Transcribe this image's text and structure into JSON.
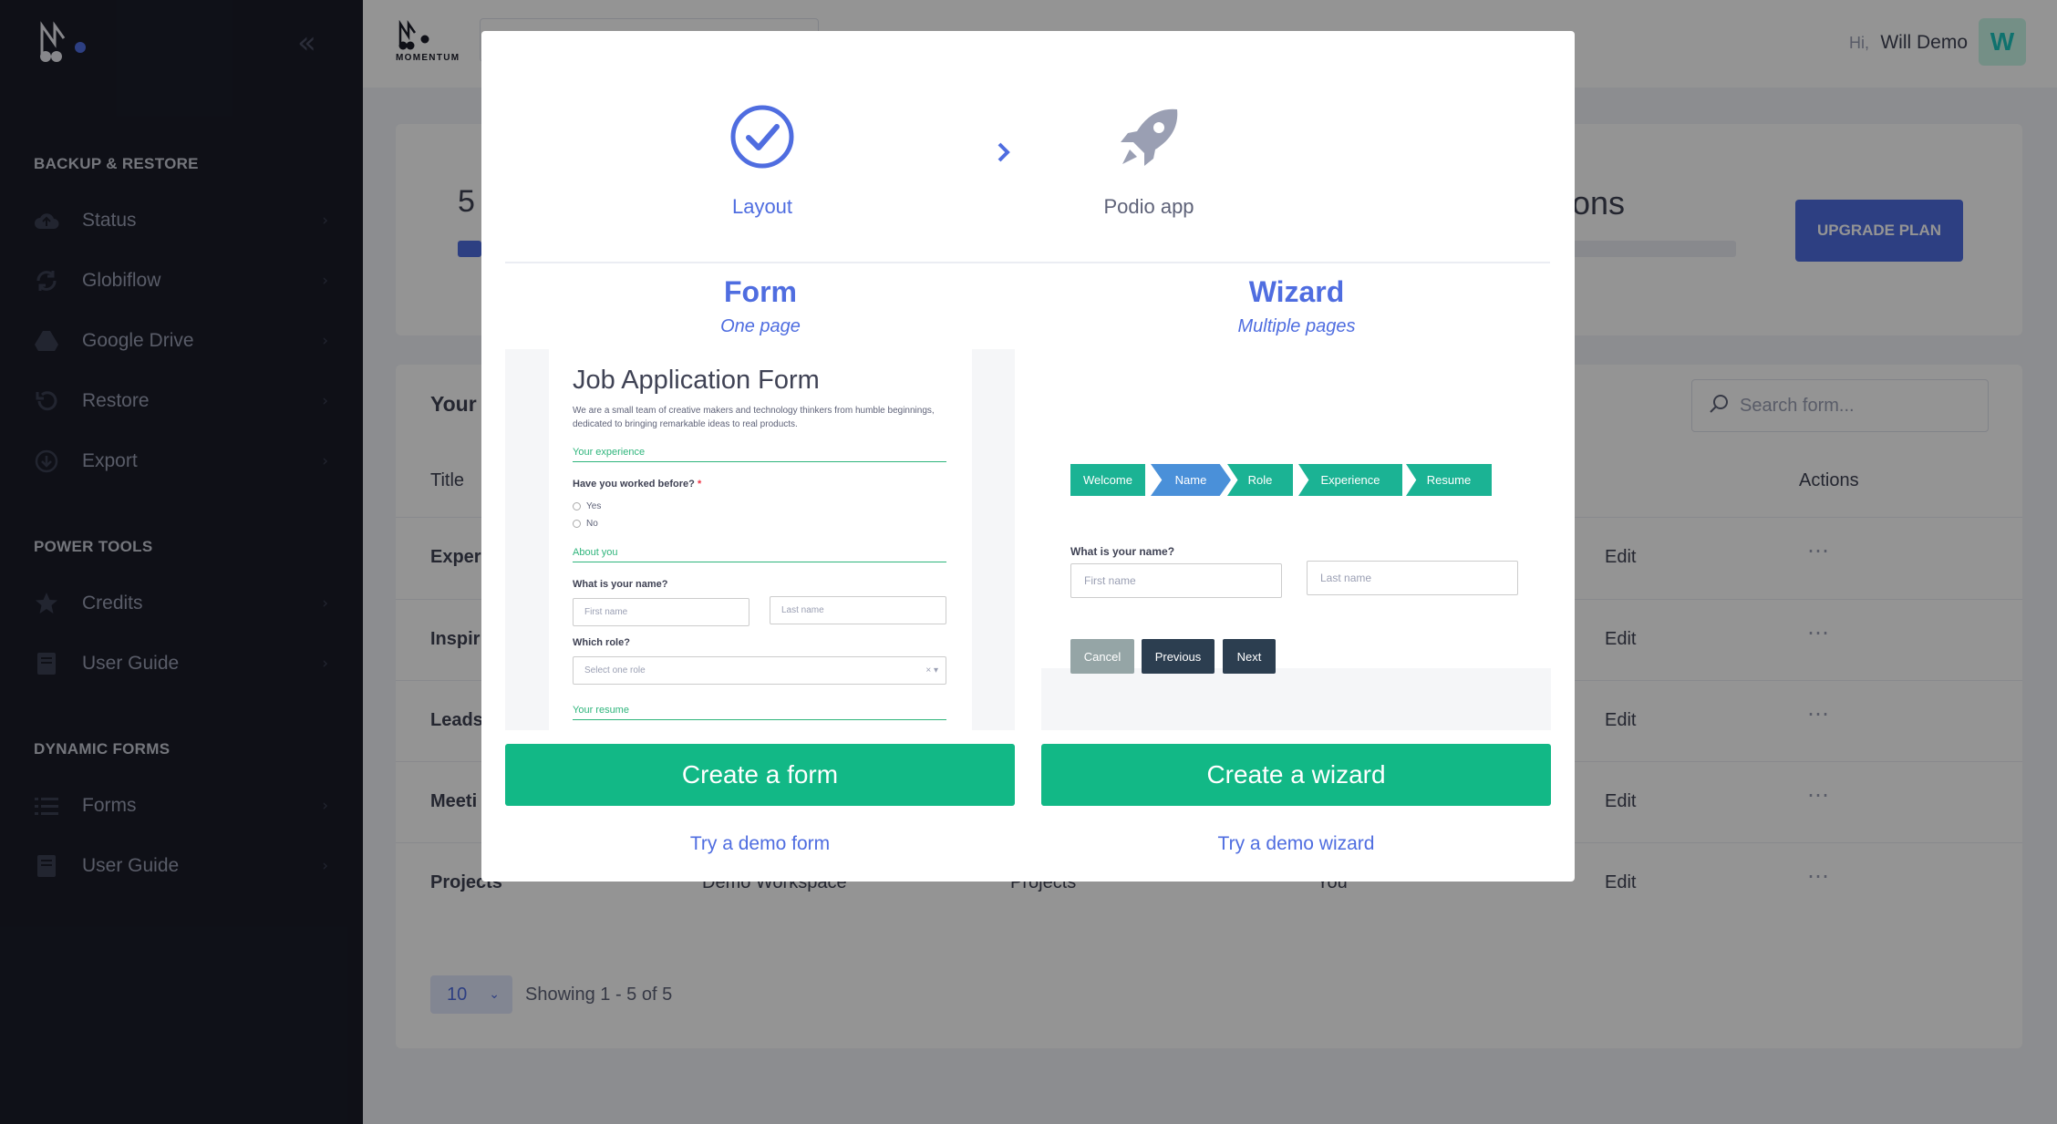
{
  "sidebar": {
    "sections": [
      {
        "title": "BACKUP & RESTORE",
        "items": [
          {
            "label": "Status"
          },
          {
            "label": "Globiflow"
          },
          {
            "label": "Google Drive"
          },
          {
            "label": "Restore"
          },
          {
            "label": "Export"
          }
        ]
      },
      {
        "title": "POWER TOOLS",
        "items": [
          {
            "label": "Credits"
          },
          {
            "label": "User Guide"
          }
        ]
      },
      {
        "title": "DYNAMIC FORMS",
        "items": [
          {
            "label": "Forms"
          },
          {
            "label": "User Guide"
          }
        ]
      }
    ]
  },
  "topbar": {
    "brand": "MOMENTUM",
    "greeting": "Hi,",
    "user_name": "Will Demo",
    "avatar_letter": "W"
  },
  "stats": {
    "number": "5",
    "right_text": "ons",
    "upgrade_label": "UPGRADE PLAN"
  },
  "forms_list": {
    "title": "Your",
    "search_placeholder": "Search form...",
    "columns": {
      "title": "Title",
      "actions": "Actions"
    },
    "rows": [
      {
        "title": "Exper",
        "action": "Edit",
        "menu": "⋯"
      },
      {
        "title": "Inspir",
        "action": "Edit",
        "menu": "⋯"
      },
      {
        "title": "Leads",
        "action": "Edit",
        "menu": "⋯"
      },
      {
        "title": "Meeti",
        "action": "Edit",
        "menu": "⋯"
      },
      {
        "title": "Projects",
        "workspace": "Demo Workspace",
        "app": "Projects",
        "owner": "You",
        "action": "Edit",
        "menu": "⋯"
      }
    ],
    "page_size": "10",
    "showing": "Showing 1 - 5 of 5"
  },
  "modal": {
    "steps": [
      {
        "label": "Layout"
      },
      {
        "label": "Podio app"
      }
    ],
    "form": {
      "title": "Form",
      "subtitle": "One page",
      "button": "Create a form",
      "demo_link": "Try a demo form",
      "preview": {
        "title": "Job Application Form",
        "description": "We are a small team of creative makers and technology thinkers from humble beginnings, dedicated to bringing remarkable ideas to real products.",
        "section1": "Your experience",
        "q1": "Have you worked before?",
        "required_mark": "*",
        "opt_yes": "Yes",
        "opt_no": "No",
        "section2": "About you",
        "q2": "What is your name?",
        "first_name": "First name",
        "last_name": "Last name",
        "q3": "Which role?",
        "select_placeholder": "Select one role",
        "section3": "Your resume"
      }
    },
    "wizard": {
      "title": "Wizard",
      "subtitle": "Multiple pages",
      "button": "Create a wizard",
      "demo_link": "Try a demo wizard",
      "preview": {
        "steps": [
          "Welcome",
          "Name",
          "Role",
          "Experience",
          "Resume"
        ],
        "question": "What is your name?",
        "first_name": "First name",
        "last_name": "Last name",
        "cancel": "Cancel",
        "previous": "Previous",
        "next": "Next"
      }
    }
  },
  "colors": {
    "accent": "#4f6de0",
    "green": "#12b886",
    "sidebar": "#1a1d29",
    "wizard_step": "#1bb394",
    "wizard_active": "#4a90d9"
  }
}
